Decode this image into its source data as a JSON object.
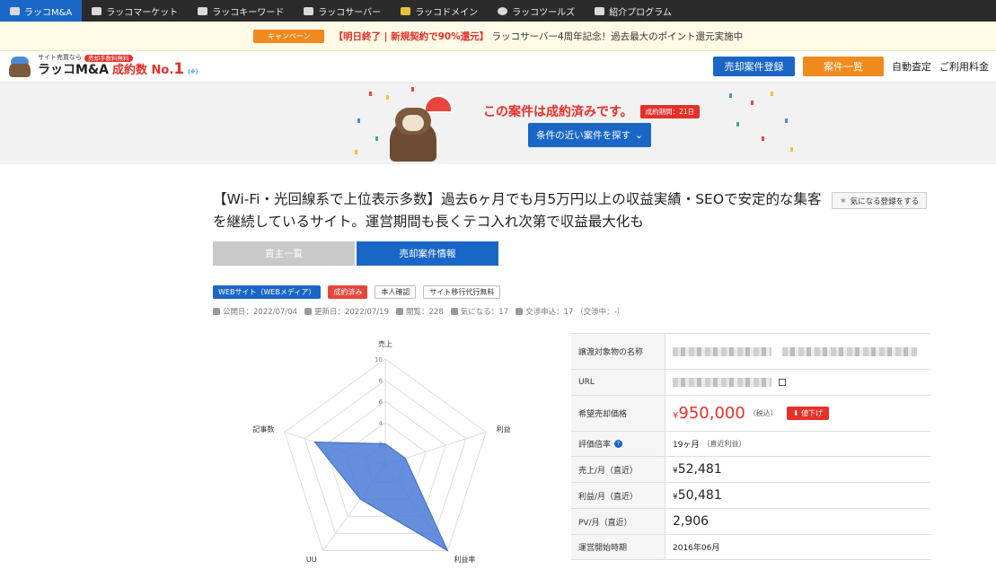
{
  "service_nav": {
    "items": [
      {
        "label": "ラッコM&A",
        "icon": "otter-icon"
      },
      {
        "label": "ラッコマーケット",
        "icon": "otter-icon"
      },
      {
        "label": "ラッコキーワード",
        "icon": "otter-icon"
      },
      {
        "label": "ラッコサーバー",
        "icon": "otter-icon"
      },
      {
        "label": "ラッコドメイン",
        "icon": "otter-icon"
      },
      {
        "label": "ラッコツールズ",
        "icon": "otter-icon"
      },
      {
        "label": "紹介プログラム",
        "icon": "otter-icon"
      }
    ]
  },
  "campaign": {
    "badge": "キャンペーン",
    "strong": "【明日終了 | 新規契約で90%還元】",
    "text": "ラッコサーバー4周年記念！過去最大のポイント還元実施中"
  },
  "header": {
    "logo_small": "サイト売買なら",
    "logo_pill": "売却手数料無料",
    "logo_main": "ラッコM&A",
    "logo_rank": "成約数 No.",
    "logo_rank_num": "1",
    "logo_note": "(※)",
    "sell_button": "売却案件登録",
    "list_button": "案件一覧",
    "link_appraisal": "自動査定",
    "link_pricing": "ご利用料金"
  },
  "banner": {
    "title": "この案件は成約済みです。",
    "period": "成約期間：21日",
    "button": "条件の近い案件を探す"
  },
  "listing": {
    "title": "【Wi-Fi・光回線系で上位表示多数】過去6ヶ月でも月5万円以上の収益実績・SEOで安定的な集客を継続しているサイト。運営期間も長くテコ入れ次第で収益最大化も",
    "fav_button": "気になる登録をする",
    "tabs": [
      "買主一覧",
      "売却案件情報"
    ],
    "tags": [
      "WEBサイト（WEBメディア）",
      "成約済み",
      "本人確認",
      "サイト移行代行無料"
    ],
    "meta": {
      "published": "公開日：2022/07/04",
      "updated": "更新日：2022/07/19",
      "views": "閲覧：228",
      "favorites": "気になる：17",
      "negotiations": "交渉申込：17 （交渉中：-）"
    }
  },
  "chart_data": {
    "type": "radar",
    "axes": [
      "売上",
      "利益",
      "利益率",
      "UU",
      "記事数"
    ],
    "rlim": [
      0,
      10
    ],
    "ticks": [
      "2",
      "4",
      "6",
      "8",
      "10"
    ],
    "series": [
      {
        "values": [
          2,
          2,
          10,
          4,
          7
        ]
      }
    ],
    "color": "#4a7bd6"
  },
  "specs": {
    "rows": [
      {
        "label": "譲渡対象物の名称",
        "kind": "blurred"
      },
      {
        "label": "URL",
        "kind": "blurred-link"
      },
      {
        "label": "希望売却価格",
        "kind": "price",
        "yen": "¥",
        "value": "950,000",
        "note": "（税込）",
        "button": "値下げ"
      },
      {
        "label": "評価倍率",
        "kind": "text",
        "value": "19ヶ月",
        "note": "（直近利益）"
      },
      {
        "label": "売上/月（直近）",
        "kind": "money",
        "yen": "¥",
        "value": "52,481"
      },
      {
        "label": "利益/月（直近）",
        "kind": "money",
        "yen": "¥",
        "value": "50,481"
      },
      {
        "label": "PV/月（直近）",
        "kind": "number",
        "value": "2,906"
      },
      {
        "label": "運営開始時期",
        "kind": "text",
        "value": "2016年06月"
      }
    ]
  }
}
